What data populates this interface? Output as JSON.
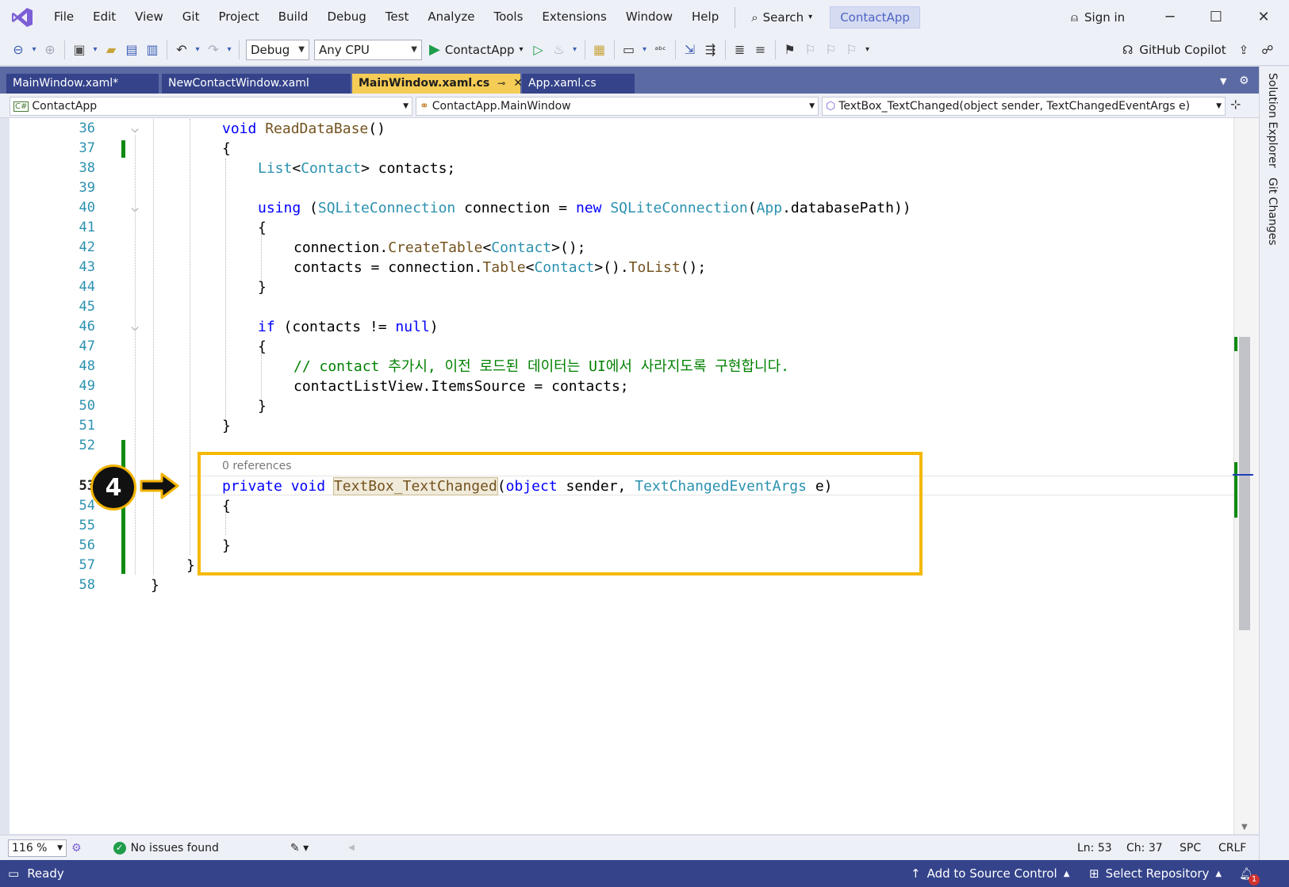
{
  "menu": [
    "File",
    "Edit",
    "View",
    "Git",
    "Project",
    "Build",
    "Debug",
    "Test",
    "Analyze",
    "Tools",
    "Extensions",
    "Window",
    "Help"
  ],
  "search_label": "Search",
  "project_name": "ContactApp",
  "sign_in": "Sign in",
  "toolbar": {
    "config": "Debug",
    "platform": "Any CPU",
    "run_target": "ContactApp",
    "copilot": "GitHub Copilot"
  },
  "tabs": [
    {
      "label": "MainWindow.xaml*",
      "active": false
    },
    {
      "label": "NewContactWindow.xaml",
      "active": false
    },
    {
      "label": "MainWindow.xaml.cs",
      "active": true
    },
    {
      "label": "App.xaml.cs",
      "active": false
    }
  ],
  "nav": {
    "project": "ContactApp",
    "class": "ContactApp.MainWindow",
    "member": "TextBox_TextChanged(object sender, TextChangedEventArgs e)"
  },
  "side_tabs": [
    "Solution Explorer",
    "Git Changes"
  ],
  "code": {
    "lines": [
      "36",
      "37",
      "38",
      "39",
      "40",
      "41",
      "42",
      "43",
      "44",
      "45",
      "46",
      "47",
      "48",
      "49",
      "50",
      "51",
      "52",
      "53",
      "54",
      "55",
      "56",
      "57",
      "58"
    ],
    "l36_kw": "void",
    "l36_name": "ReadDataBase",
    "l36_tail": "()",
    "l37": "{",
    "l38_type": "List",
    "l38_lt": "<",
    "l38_type2": "Contact",
    "l38_tail": "> contacts;",
    "l40_kw": "using",
    "l40_a": " (",
    "l40_type": "SQLiteConnection",
    "l40_b": " connection = ",
    "l40_new": "new",
    "l40_sp": " ",
    "l40_type2": "SQLiteConnection",
    "l40_c": "(",
    "l40_app": "App",
    "l40_d": ".databasePath))",
    "l41": "{",
    "l42_a": "connection.",
    "l42_m": "CreateTable",
    "l42_b": "<",
    "l42_t": "Contact",
    "l42_c": ">();",
    "l43_a": "contacts = connection.",
    "l43_m": "Table",
    "l43_b": "<",
    "l43_t": "Contact",
    "l43_c": ">().",
    "l43_m2": "ToList",
    "l43_d": "();",
    "l44": "}",
    "l46_kw": "if",
    "l46_a": " (contacts != ",
    "l46_null": "null",
    "l46_b": ")",
    "l47": "{",
    "l48_comment": "// contact 추가시, 이전 로드된 데이터는 UI에서 사라지도록 구현합니다.",
    "l49": "contactListView.ItemsSource = contacts;",
    "l50": "}",
    "l51": "}",
    "refs": "0 references",
    "l53_kw1": "private",
    "l53_kw2": "void",
    "l53_name": "TextBox_TextChanged",
    "l53_a": "(",
    "l53_obj": "object",
    "l53_b": " sender, ",
    "l53_type": "TextChangedEventArgs",
    "l53_c": " e)",
    "l54": "{",
    "l56": "}",
    "l57": "}",
    "l58": "}"
  },
  "callout_number": "4",
  "editor_status": {
    "zoom": "116 %",
    "issues": "No issues found",
    "ln": "Ln: 53",
    "ch": "Ch: 37",
    "spc": "SPC",
    "crlf": "CRLF"
  },
  "status": {
    "ready": "Ready",
    "add_source": "Add to Source Control",
    "select_repo": "Select Repository",
    "notif_count": "1"
  },
  "colors": {
    "accent": "#34438a",
    "active_tab": "#f5cc55",
    "highlight_box": "#f5b800",
    "change_bar": "#108a10"
  }
}
